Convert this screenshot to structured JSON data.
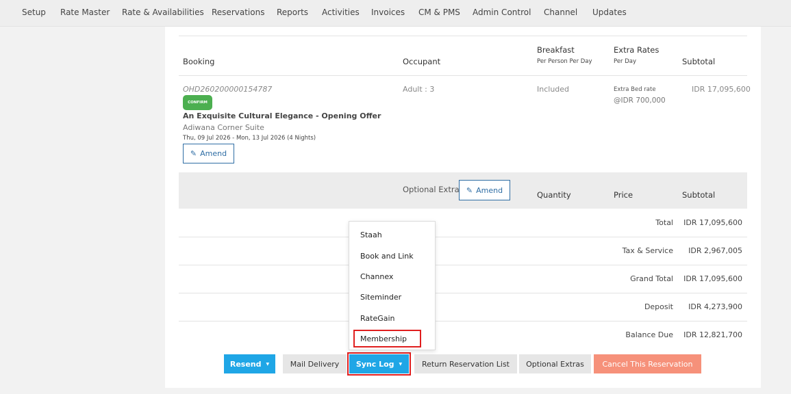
{
  "nav": {
    "items": [
      "Setup",
      "Rate Master",
      "Rate & Availabilities",
      "Reservations",
      "Reports",
      "Activities",
      "Invoices",
      "CM & PMS",
      "Admin Control",
      "Channel",
      "Updates"
    ]
  },
  "table": {
    "headers": {
      "booking": "Booking",
      "occupant": "Occupant",
      "breakfast": "Breakfast",
      "breakfast_sub": "Per Person Per Day",
      "extra_rates": "Extra Rates",
      "extra_rates_sub": "Per Day",
      "subtotal": "Subtotal"
    },
    "booking": {
      "id": "OHD260200000154787",
      "status": "CONFIRM",
      "title": "An Exquisite Cultural Elegance - Opening Offer",
      "room": "Adiwana Corner Suite",
      "dates": "Thu, 09 Jul 2026 - Mon, 13 Jul 2026 (4 Nights)",
      "amend_label": "Amend",
      "occupant": "Adult : 3",
      "breakfast": "Included",
      "extra_rate_label": "Extra Bed rate",
      "extra_rate_value": "@IDR 700,000",
      "subtotal": "IDR 17,095,600"
    }
  },
  "optional_extra": {
    "label": "Optional Extra",
    "amend_label": "Amend",
    "quantity": "Quantity",
    "price": "Price",
    "subtotal": "Subtotal"
  },
  "totals": [
    {
      "label": "Total",
      "value": "IDR 17,095,600"
    },
    {
      "label": "Tax & Service",
      "value": "IDR 2,967,005"
    },
    {
      "label": "Grand Total",
      "value": "IDR 17,095,600"
    },
    {
      "label": "Deposit",
      "value": "IDR 4,273,900"
    },
    {
      "label": "Balance Due",
      "value": "IDR 12,821,700"
    }
  ],
  "sync_menu": {
    "items": [
      "Staah",
      "Book and Link",
      "Channex",
      "Siteminder",
      "RateGain",
      "Membership"
    ],
    "highlighted": "Membership"
  },
  "actions": {
    "resend": "Resend",
    "mail_delivery": "Mail Delivery",
    "sync_log": "Sync Log",
    "return_list": "Return Reservation List",
    "optional_extras": "Optional Extras",
    "cancel": "Cancel This Reservation"
  },
  "colors": {
    "primary_blue": "#1fa6e6",
    "confirm_green": "#4caf50",
    "cancel_orange": "#f6917a",
    "highlight_red": "#e01e1e",
    "amend_blue": "#2e6da4"
  },
  "icons": {
    "amend": "pencil-icon",
    "dropdown": "caret-down-icon"
  }
}
